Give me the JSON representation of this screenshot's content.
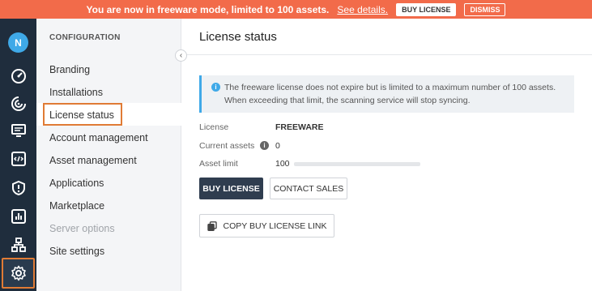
{
  "banner": {
    "message": "You are now in freeware mode, limited to 100 assets.",
    "link_text": "See details.",
    "buy_label": "BUY LICENSE",
    "dismiss_label": "DISMISS",
    "color": "#f26b4a"
  },
  "rail": {
    "avatar_initial": "N",
    "icons": [
      "dashboard-icon",
      "scan-icon",
      "monitor-icon",
      "code-icon",
      "shield-icon",
      "report-icon",
      "workflow-icon",
      "settings-icon"
    ],
    "active_icon": "settings-icon"
  },
  "sidebar": {
    "heading": "CONFIGURATION",
    "items": [
      {
        "label": "Branding"
      },
      {
        "label": "Installations"
      },
      {
        "label": "License status"
      },
      {
        "label": "Account management"
      },
      {
        "label": "Asset management"
      },
      {
        "label": "Applications"
      },
      {
        "label": "Marketplace"
      },
      {
        "label": "Server options"
      },
      {
        "label": "Site settings"
      }
    ],
    "active_item": "License status",
    "disabled_item": "Server options"
  },
  "main": {
    "title": "License status",
    "info_text": "The freeware license does not expire but is limited to a maximum number of 100 assets. When exceeding that limit, the scanning service will stop syncing.",
    "license_label": "License",
    "license_value": "FREEWARE",
    "current_assets_label": "Current assets",
    "current_assets_value": "0",
    "asset_limit_label": "Asset limit",
    "asset_limit_value": "100",
    "asset_usage_fraction": 0,
    "buy_license_label": "BUY LICENSE",
    "contact_sales_label": "CONTACT SALES",
    "copy_link_label": "COPY BUY LICENSE LINK"
  },
  "colors": {
    "accent": "#3fa9e8",
    "highlight": "#e07b35",
    "rail_bg": "#1f2d3d"
  }
}
